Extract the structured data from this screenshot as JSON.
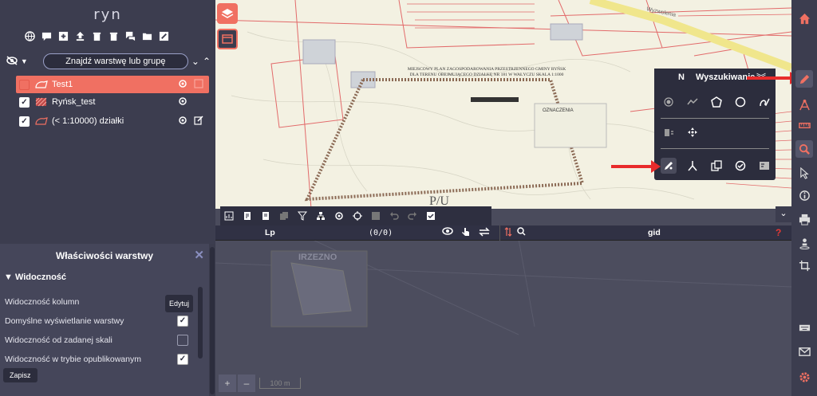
{
  "app": {
    "title": "ryn"
  },
  "layer_search": {
    "placeholder": "Znajdź warstwę lub grupę"
  },
  "layers": [
    {
      "label": "Test1",
      "checked": false,
      "active": true
    },
    {
      "label": "Ryńsk_test",
      "checked": true,
      "active": false
    },
    {
      "label": "(< 1:10000) działki",
      "checked": true,
      "active": false
    }
  ],
  "properties": {
    "title": "Właściwości warstwy",
    "section": "Widoczność",
    "rows": [
      {
        "label": "Widoczność kolumn",
        "value": ""
      },
      {
        "label": "Domyślne wyświetlanie warstwy",
        "value": "✓"
      },
      {
        "label": "Widoczność od zadanej skali",
        "value": ""
      },
      {
        "label": "Widoczność w trybie opublikowanym",
        "value": "✓"
      }
    ],
    "edit_label": "Edytuj",
    "save_label": "Zapisz"
  },
  "attribute_table": {
    "col_lp": "Lp",
    "count": "(0/0)",
    "col_gid": "gid",
    "help": "?"
  },
  "draw_popup": {
    "tab_short": "N",
    "title": "Wyszukiwanie",
    "chevron": "︾"
  },
  "map": {
    "plan_title": "MIEJSCOWY PLAN ZAGOSPODAROWANIA PRZESTRZENNEGO GMINY RYŃSK DLA TERENU OBEJMUJĄCEGO DZIAŁKĘ NR 181 W WAŁYCZU SKALA 1:1000",
    "legend_label": "OZNACZENIA",
    "zone_label": "P/U",
    "inset_label": "IRZEZNO",
    "scale_label": "100 m",
    "street_label": "Wyzwolenia"
  },
  "colors": {
    "accent": "#f07062",
    "panel": "#3c3d4f",
    "danger": "#e53935"
  }
}
